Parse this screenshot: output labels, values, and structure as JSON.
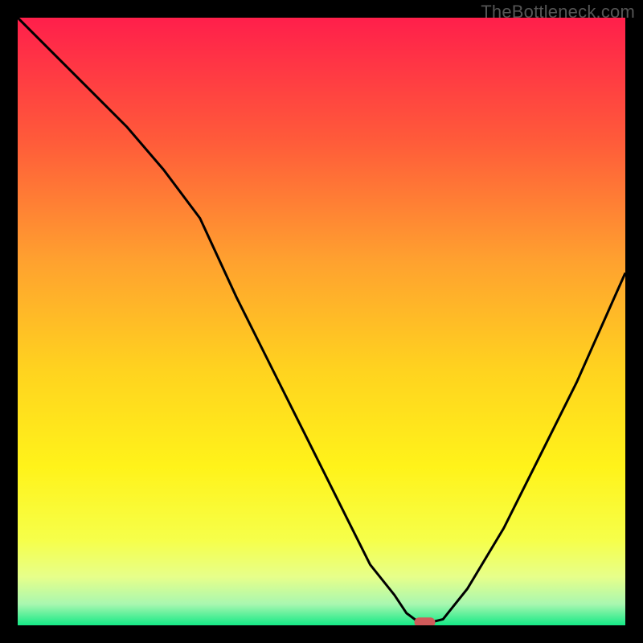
{
  "watermark": "TheBottleneck.com",
  "chart_data": {
    "type": "line",
    "title": "",
    "xlabel": "",
    "ylabel": "",
    "xlim": [
      0,
      100
    ],
    "ylim": [
      0,
      100
    ],
    "grid": false,
    "legend": false,
    "gradient_stops": [
      {
        "offset": 0.0,
        "color": "#ff1f4b"
      },
      {
        "offset": 0.2,
        "color": "#ff5a3a"
      },
      {
        "offset": 0.4,
        "color": "#ffa12f"
      },
      {
        "offset": 0.58,
        "color": "#ffd31f"
      },
      {
        "offset": 0.74,
        "color": "#fff31a"
      },
      {
        "offset": 0.86,
        "color": "#f6ff4a"
      },
      {
        "offset": 0.92,
        "color": "#e7ff8a"
      },
      {
        "offset": 0.965,
        "color": "#a9f7b0"
      },
      {
        "offset": 1.0,
        "color": "#15e986"
      }
    ],
    "series": [
      {
        "name": "bottleneck-curve",
        "x": [
          0,
          6,
          12,
          18,
          24,
          30,
          36,
          42,
          48,
          54,
          58,
          62,
          64,
          66,
          68,
          70,
          74,
          80,
          86,
          92,
          100
        ],
        "y": [
          100,
          94,
          88,
          82,
          75,
          67,
          54,
          42,
          30,
          18,
          10,
          5,
          2,
          0.5,
          0.5,
          1,
          6,
          16,
          28,
          40,
          58
        ]
      }
    ],
    "marker": {
      "name": "optimal-point",
      "x": 67,
      "y": 0.5,
      "color": "#d05a5a"
    }
  }
}
